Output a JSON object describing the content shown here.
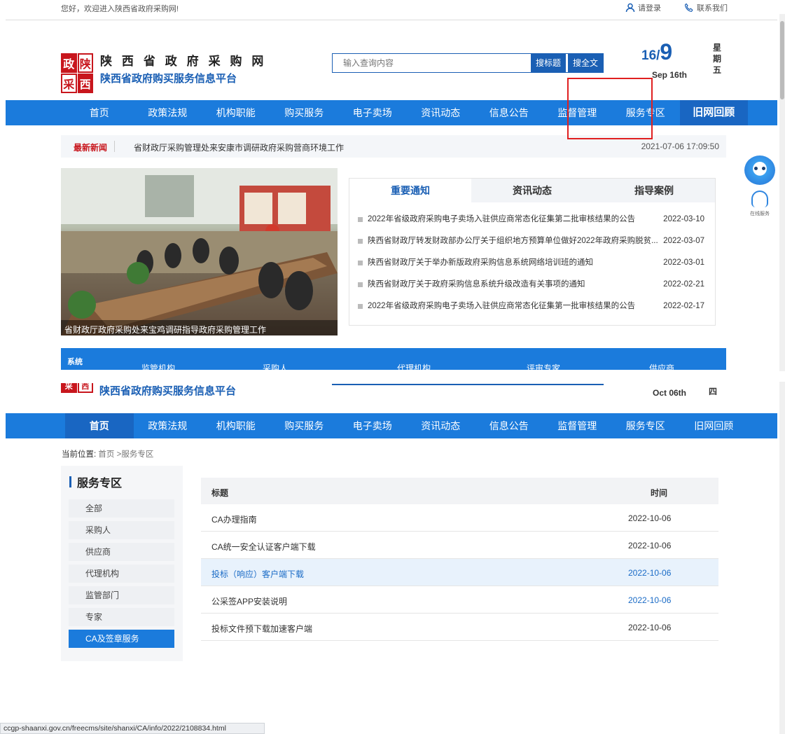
{
  "topbar": {
    "greeting": "您好，欢迎进入陕西省政府采购网!",
    "login": "请登录",
    "contact": "联系我们"
  },
  "logo": {
    "seal": [
      "政",
      "陕",
      "采",
      "西"
    ],
    "title": "陕 西 省 政 府 采 购 网",
    "subtitle": "陕西省政府购买服务信息平台"
  },
  "search": {
    "placeholder": "输入查询内容",
    "btn_title": "搜标题",
    "btn_full": "搜全文"
  },
  "date": {
    "num": "16",
    "sep": "/",
    "big": "9",
    "sub": "Sep 16th",
    "week": "星期五"
  },
  "nav": [
    "首页",
    "政策法规",
    "机构职能",
    "购买服务",
    "电子卖场",
    "资讯动态",
    "信息公告",
    "监督管理",
    "服务专区",
    "旧网回顾"
  ],
  "news": {
    "tag": "最新新闻",
    "text": "省财政厅采购管理处来安康市调研政府采购营商环境工作",
    "time": "2021-07-06 17:09:50"
  },
  "photo": {
    "caption": "省财政厅政府采购处来宝鸡调研指导政府采购管理工作"
  },
  "notice": {
    "tabs": [
      "重要通知",
      "资讯动态",
      "指导案例"
    ],
    "items": [
      {
        "title": "2022年省级政府采购电子卖场入驻供应商常态化征集第二批审核结果的公告",
        "date": "2022-03-10"
      },
      {
        "title": "陕西省财政厅转发财政部办公厅关于组织地方预算单位做好2022年政府采购脱贫...",
        "date": "2022-03-07"
      },
      {
        "title": "陕西省财政厅关于举办新版政府采购信息系统网络培训班的通知",
        "date": "2022-03-01"
      },
      {
        "title": "陕西省财政厅关于政府采购信息系统升级改造有关事项的通知",
        "date": "2022-02-21"
      },
      {
        "title": "2022年省级政府采购电子卖场入驻供应商常态化征集第一批审核结果的公告",
        "date": "2022-02-17"
      }
    ]
  },
  "band": {
    "vertical": "系统",
    "items": [
      "监管机构",
      "采购人",
      "代理机构",
      "评审专家",
      "供应商"
    ]
  },
  "second": {
    "date": "Oct 06th",
    "week": "四"
  },
  "breadcrumb": {
    "label": "当前位置:",
    "path": "首页 >服务专区"
  },
  "sidebar": {
    "title": "服务专区",
    "items": [
      "全部",
      "采购人",
      "供应商",
      "代理机构",
      "监管部门",
      "专家",
      "CA及签章服务"
    ]
  },
  "table": {
    "headers": [
      "标题",
      "时间"
    ],
    "rows": [
      {
        "title": "CA办理指南",
        "date": "2022-10-06"
      },
      {
        "title": "CA统一安全认证客户端下载",
        "date": "2022-10-06"
      },
      {
        "title": "投标（响应）客户端下载",
        "date": "2022-10-06"
      },
      {
        "title": "公采签APP安装说明",
        "date": "2022-10-06"
      },
      {
        "title": "投标文件预下载加速客户端",
        "date": "2022-10-06"
      }
    ]
  },
  "service": {
    "label": "在线服务"
  },
  "status": {
    "url": "ccgp-shaanxi.gov.cn/freecms/site/shanxi/CA/info/2022/2108834.html"
  }
}
